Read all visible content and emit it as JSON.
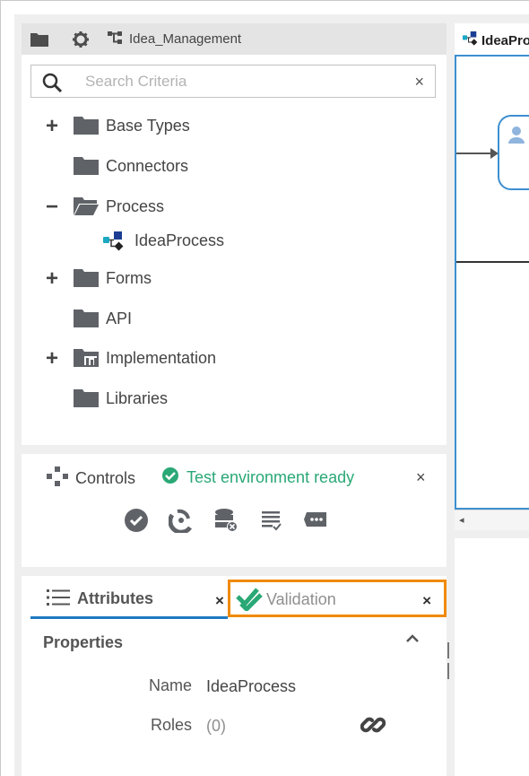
{
  "toolbar": {
    "folder_icon": "folder-icon",
    "settings_icon": "gear-icon",
    "project_icon": "project-tree-icon",
    "project_name": "Idea_Management"
  },
  "search": {
    "placeholder": "Search Criteria",
    "value": "",
    "clear_glyph": "×"
  },
  "tree": {
    "items": [
      {
        "label": "Base Types",
        "expander": "+",
        "icon": "folder-icon"
      },
      {
        "label": "Connectors",
        "expander": "",
        "icon": "folder-icon"
      },
      {
        "label": "Process",
        "expander": "−",
        "icon": "folder-open-icon"
      },
      {
        "label": "IdeaProcess",
        "expander": "",
        "icon": "process-icon"
      },
      {
        "label": "Forms",
        "expander": "+",
        "icon": "folder-icon"
      },
      {
        "label": "API",
        "expander": "",
        "icon": "folder-icon"
      },
      {
        "label": "Implementation",
        "expander": "+",
        "icon": "folder-implementation-icon"
      },
      {
        "label": "Libraries",
        "expander": "",
        "icon": "folder-icon"
      }
    ]
  },
  "controls": {
    "title": "Controls",
    "status": "Test environment ready",
    "close_glyph": "×",
    "actions": [
      "validate-icon",
      "deploy-icon",
      "remove-database-icon",
      "report-icon",
      "message-icon"
    ]
  },
  "attributes_panel": {
    "tabs": [
      {
        "label": "Attributes",
        "close": "×"
      },
      {
        "label": "Validation",
        "close": "×"
      }
    ],
    "section_title": "Properties",
    "collapse_glyph": "^",
    "properties": [
      {
        "key": "Name",
        "value": "IdeaProcess"
      },
      {
        "key": "Roles",
        "value": "(0)"
      }
    ]
  },
  "editor": {
    "tab_label": "IdeaProcess",
    "scroll_left_glyph": "◂"
  },
  "colors": {
    "accent_blue": "#1f7ac2",
    "highlight_orange": "#f08a00",
    "status_green": "#2aa876",
    "folder_gray": "#5f6368"
  }
}
